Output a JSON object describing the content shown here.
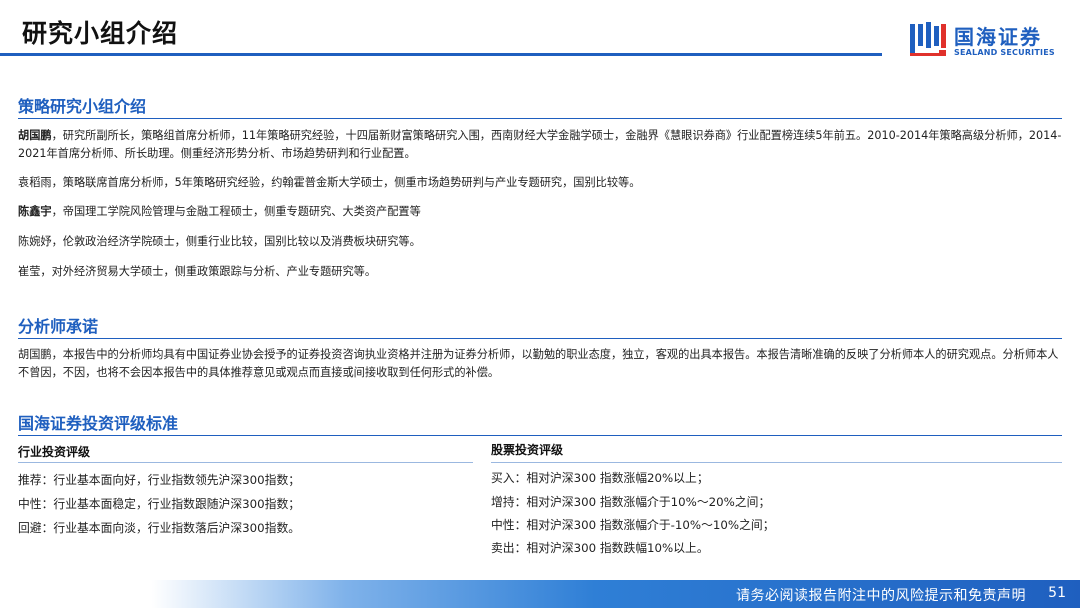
{
  "header": {
    "title": "研究小组介绍",
    "logo_cn": "国海证券",
    "logo_en": "SEALAND SECURITIES"
  },
  "team": {
    "heading": "策略研究小组介绍",
    "members": [
      {
        "name": "胡国鹏",
        "text": "，研究所副所长，策略组首席分析师，11年策略研究经验，十四届新财富策略研究入围，西南财经大学金融学硕士，金融界《慧眼识券商》行业配置榜连续5年前五。2010-2014年策略高级分析师，2014-2021年首席分析师、所长助理。侧重经济形势分析、市场趋势研判和行业配置。"
      },
      {
        "name": "",
        "text": "袁稻雨，策略联席首席分析师，5年策略研究经验，约翰霍普金斯大学硕士，侧重市场趋势研判与产业专题研究，国别比较等。"
      },
      {
        "name": "陈鑫宇",
        "text": "，帝国理工学院风险管理与金融工程硕士，侧重专题研究、大类资产配置等"
      },
      {
        "name": "",
        "text": "陈婉妤，伦敦政治经济学院硕士，侧重行业比较，国别比较以及消费板块研究等。"
      },
      {
        "name": "",
        "text": "崔莹，对外经济贸易大学硕士，侧重政策跟踪与分析、产业专题研究等。"
      }
    ]
  },
  "commitment": {
    "heading": "分析师承诺",
    "text": "胡国鹏，本报告中的分析师均具有中国证券业协会授予的证券投资咨询执业资格并注册为证券分析师，以勤勉的职业态度，独立，客观的出具本报告。本报告清晰准确的反映了分析师本人的研究观点。分析师本人不曾因，不因，也将不会因本报告中的具体推荐意见或观点而直接或间接收取到任何形式的补偿。"
  },
  "ratings": {
    "heading": "国海证券投资评级标准",
    "industry": {
      "title": "行业投资评级",
      "items": [
        "推荐：行业基本面向好，行业指数领先沪深300指数；",
        "中性：行业基本面稳定，行业指数跟随沪深300指数；",
        "回避：行业基本面向淡，行业指数落后沪深300指数。"
      ]
    },
    "stock": {
      "title": "股票投资评级",
      "items": [
        "买入：相对沪深300 指数涨幅20%以上；",
        "增持：相对沪深300 指数涨幅介于10%～20%之间；",
        "中性：相对沪深300 指数涨幅介于-10%～10%之间；",
        "卖出：相对沪深300 指数跌幅10%以上。"
      ]
    }
  },
  "footer": {
    "disclaimer": "请务必阅读报告附注中的风险提示和免责声明",
    "page_number": "51"
  },
  "colors": {
    "brand_blue": "#1f5fbf"
  }
}
